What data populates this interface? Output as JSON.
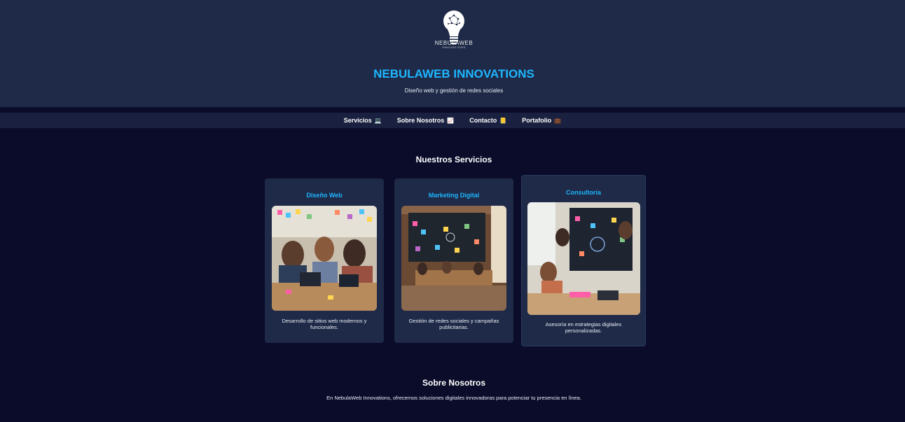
{
  "header": {
    "logo_text": "NEBULAWEB",
    "logo_subtext": "INNOVATIONS",
    "title": "NEBULAWEB INNOVATIONS",
    "subtitle": "Diseño web y gestión de redes sociales"
  },
  "nav": {
    "items": [
      {
        "label": "Servicios",
        "icon": "laptop-icon",
        "glyph": "💻"
      },
      {
        "label": "Sobre Nosotros",
        "icon": "chart-icon",
        "glyph": "📈"
      },
      {
        "label": "Contacto",
        "icon": "notebook-icon",
        "glyph": "📒"
      },
      {
        "label": "Portafolio",
        "icon": "briefcase-icon",
        "glyph": "💼"
      }
    ]
  },
  "services": {
    "title": "Nuestros Servicios",
    "cards": [
      {
        "title": "Diseño Web",
        "description": "Desarrollo de sitios web modernos y funcionales."
      },
      {
        "title": "Marketing Digital",
        "description": "Gestión de redes sociales y campañas publicitarias."
      },
      {
        "title": "Consultoría",
        "description": "Asesoría en estrategias digitales personalizadas."
      }
    ]
  },
  "about": {
    "title": "Sobre Nosotros",
    "text": "En NebulaWeb Innovations, ofrecemos soluciones digitales innovadoras para potenciar tu presencia en línea."
  },
  "colors": {
    "accent": "#1fb6ff",
    "header_bg": "#1e2a47",
    "page_bg": "#0a0c2a",
    "card_bg": "#1e2a47"
  }
}
